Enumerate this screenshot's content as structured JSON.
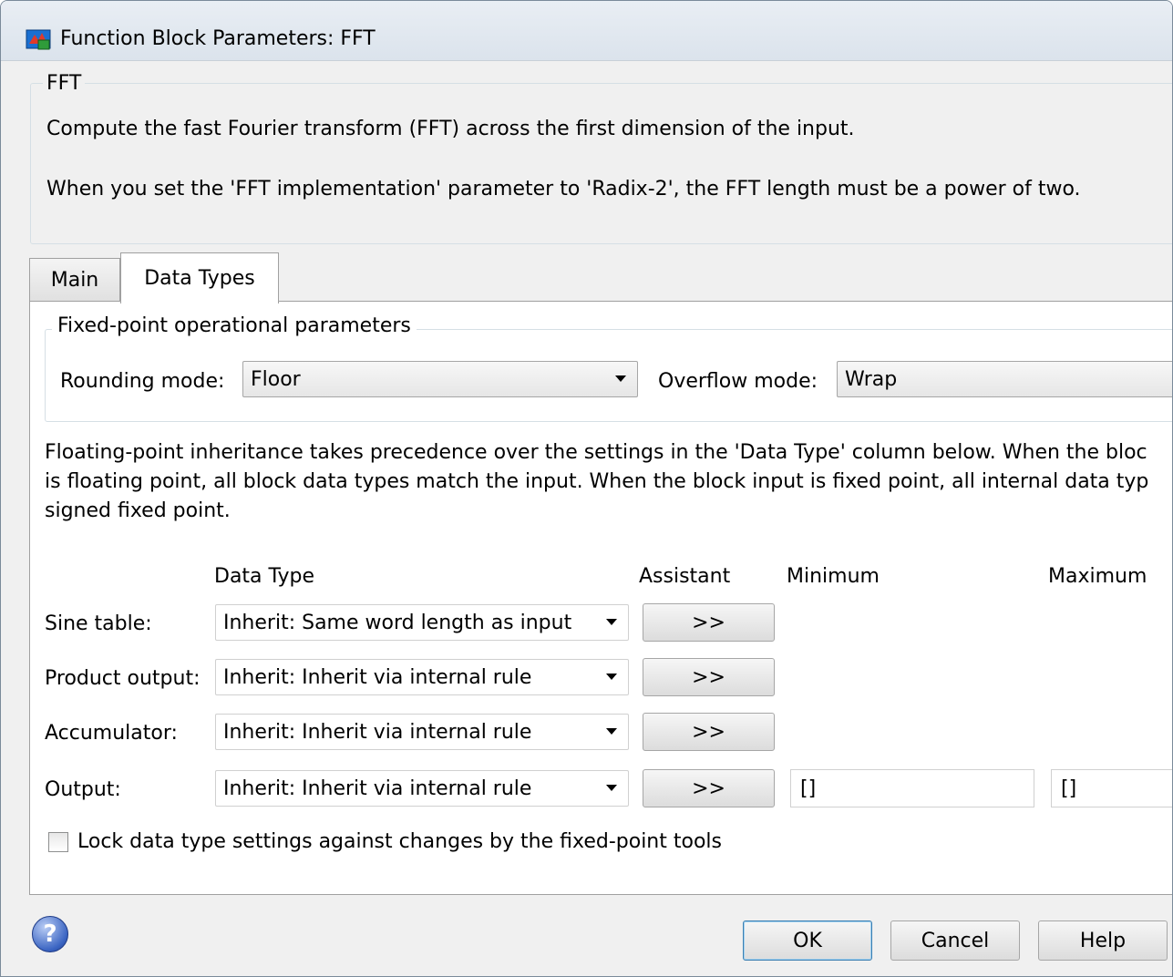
{
  "window": {
    "title": "Function Block Parameters: FFT"
  },
  "block": {
    "group_title": "FFT",
    "description_1": "Compute the fast Fourier transform (FFT) across the first dimension of the input.",
    "description_2": "When you set the 'FFT implementation' parameter to 'Radix-2', the FFT length must be a power of two."
  },
  "tabs": [
    {
      "label": "Main",
      "active": false
    },
    {
      "label": "Data Types",
      "active": true
    }
  ],
  "fixed_point": {
    "group_title": "Fixed-point operational parameters",
    "rounding_label": "Rounding mode:",
    "rounding_value": "Floor",
    "overflow_label": "Overflow mode:",
    "overflow_value": "Wrap"
  },
  "inheritance_note": {
    "line_1": "Floating-point inheritance takes precedence over the settings in the 'Data Type' column below. When the bloc",
    "line_2": "is floating point, all block data types match the input. When the block input is fixed point, all internal data typ",
    "line_3": "signed fixed point."
  },
  "table": {
    "headers": {
      "data_type": "Data Type",
      "assistant": "Assistant",
      "minimum": "Minimum",
      "maximum": "Maximum"
    },
    "rows": [
      {
        "label": "Sine table:",
        "data_type": "Inherit: Same word length as input",
        "assistant": ">>"
      },
      {
        "label": "Product output:",
        "data_type": "Inherit: Inherit via internal rule",
        "assistant": ">>"
      },
      {
        "label": "Accumulator:",
        "data_type": "Inherit: Inherit via internal rule",
        "assistant": ">>"
      },
      {
        "label": "Output:",
        "data_type": "Inherit: Inherit via internal rule",
        "assistant": ">>",
        "minimum": "[]",
        "maximum": "[]"
      }
    ]
  },
  "lock": {
    "label": "Lock data type settings against changes by the fixed-point tools",
    "checked": false
  },
  "buttons": {
    "ok": "OK",
    "cancel": "Cancel",
    "help": "Help"
  },
  "icons": {
    "app": "simulink-block-icon",
    "help": "question-mark-icon"
  }
}
